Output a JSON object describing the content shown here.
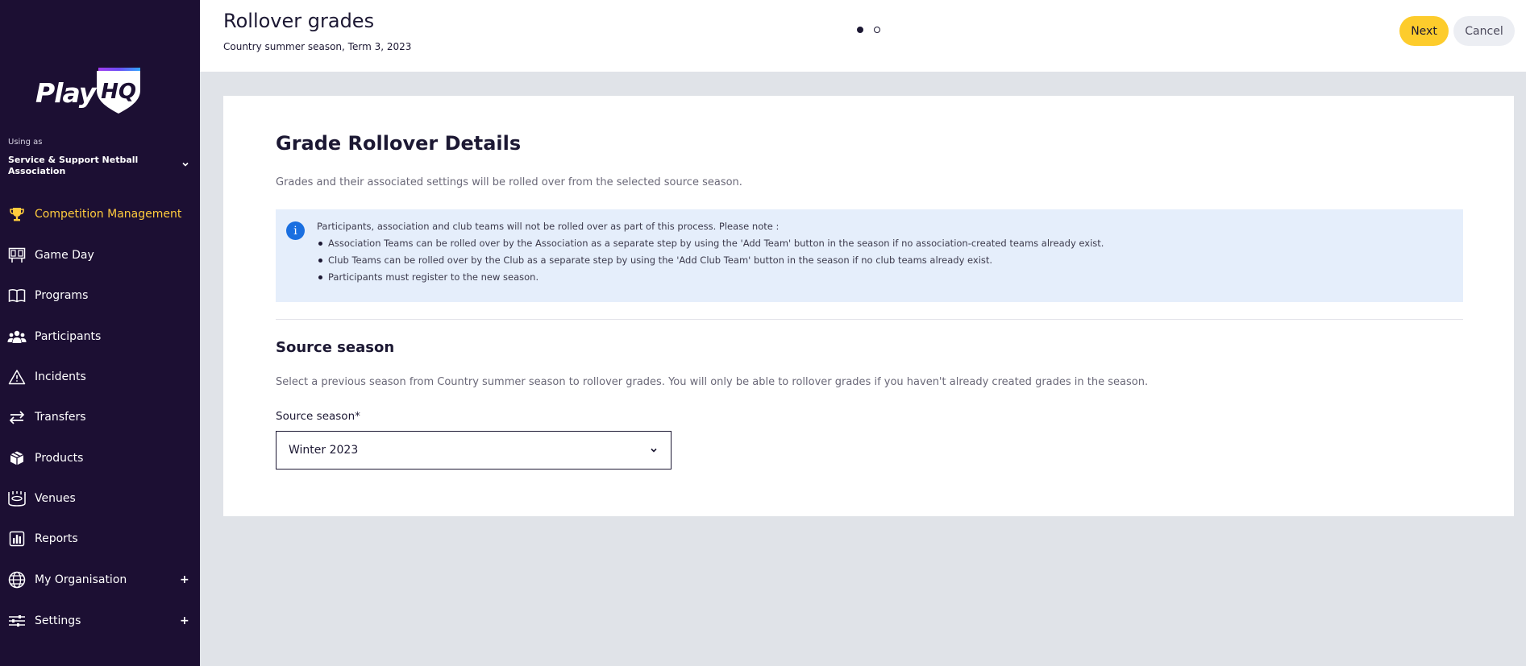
{
  "sidebar": {
    "logo_text": "Play",
    "logo_hq": "HQ",
    "using_as_label": "Using as",
    "organisation": "Service & Support Netball Association",
    "nav": [
      {
        "label": "Competition Management",
        "icon": "trophy-icon",
        "active": true
      },
      {
        "label": "Game Day",
        "icon": "scoreboard-icon"
      },
      {
        "label": "Programs",
        "icon": "book-icon"
      },
      {
        "label": "Participants",
        "icon": "people-icon"
      },
      {
        "label": "Incidents",
        "icon": "warning-icon"
      },
      {
        "label": "Transfers",
        "icon": "arrows-icon"
      },
      {
        "label": "Products",
        "icon": "box-icon"
      },
      {
        "label": "Venues",
        "icon": "stadium-icon"
      },
      {
        "label": "Reports",
        "icon": "chart-icon"
      },
      {
        "label": "My Organisation",
        "icon": "globe-icon",
        "expandable": true
      },
      {
        "label": "Settings",
        "icon": "sliders-icon",
        "expandable": true
      }
    ],
    "expand_symbol": "+"
  },
  "header": {
    "title": "Rollover grades",
    "subtitle": "Country summer season, Term 3, 2023",
    "steps_total": 2,
    "step_current": 1,
    "next_label": "Next",
    "cancel_label": "Cancel"
  },
  "card": {
    "title": "Grade Rollover Details",
    "description": "Grades and their associated settings will be rolled over from the selected source season.",
    "info": {
      "icon_glyph": "i",
      "intro": "Participants, association and club teams will not be rolled over as part of this process. Please note :",
      "items": [
        "Association Teams can be rolled over by the Association as a separate step by using the 'Add Team' button in the season if no association-created teams already exist.",
        "Club Teams can be rolled over by the Club as a separate step by using the 'Add Club Team' button in the season if no club teams already exist.",
        "Participants must register to the new season."
      ]
    },
    "source_section": {
      "title": "Source season",
      "description": "Select a previous season from Country summer season to rollover grades. You will only be able to rollover grades if you haven't already created grades in the season.",
      "field_label": "Source season*",
      "selected_value": "Winter 2023"
    }
  },
  "colors": {
    "sidebar_bg": "#1c0f33",
    "accent_yellow": "#fdcc2c",
    "active_nav": "#ffcb3d",
    "info_bg": "#e5eefb",
    "info_icon": "#1a6fe0"
  }
}
